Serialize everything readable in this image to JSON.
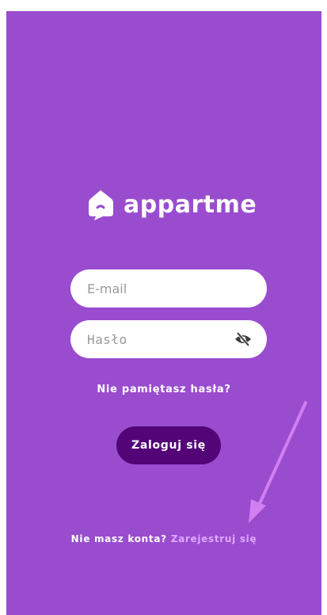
{
  "app": {
    "logo_text": "appartme",
    "logo_icon": "house-icon"
  },
  "form": {
    "email": {
      "value": "",
      "placeholder": "E-mail"
    },
    "password": {
      "value": "",
      "placeholder": "Hasło",
      "toggle_icon": "eye-slash-icon"
    }
  },
  "links": {
    "forgot_password": "Nie pamiętasz hasła?"
  },
  "buttons": {
    "login": "Zaloguj się"
  },
  "signup": {
    "prompt": "Nie masz konta?",
    "link": "Zarejestruj się"
  },
  "annotation": {
    "arrow_icon": "pointer-arrow-icon",
    "arrow_color": "#d27ff0"
  },
  "colors": {
    "background": "#9a4ccf",
    "button": "#530578",
    "link_accent": "#e0a8ff"
  }
}
